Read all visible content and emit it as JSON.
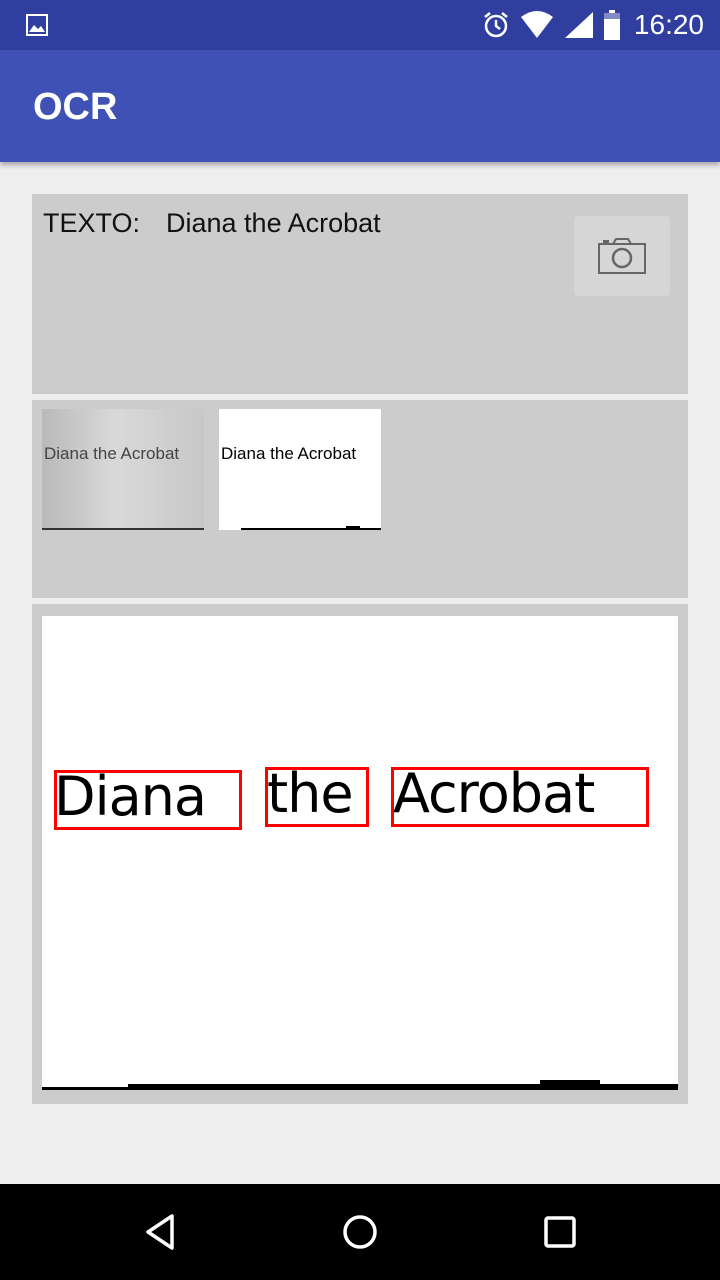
{
  "status_bar": {
    "time": "16:20",
    "icons": [
      "gallery-icon",
      "alarm-icon",
      "wifi-icon",
      "signal-icon",
      "battery-icon"
    ]
  },
  "app_bar": {
    "title": "OCR"
  },
  "result": {
    "label": "TEXTO:",
    "value": "Diana the Acrobat",
    "camera_icon": "camera-icon"
  },
  "thumbnails": {
    "original_text": "Diana the Acrobat",
    "processed_text": "Diana the Acrobat"
  },
  "preview": {
    "words": [
      "Diana",
      "the",
      "Acrobat"
    ],
    "box_color": "#ff0000"
  },
  "nav_bar": {
    "icons": [
      "back-icon",
      "home-icon",
      "recents-icon"
    ]
  },
  "colors": {
    "primary": "#3f51b5",
    "primary_dark": "#303f9f"
  }
}
